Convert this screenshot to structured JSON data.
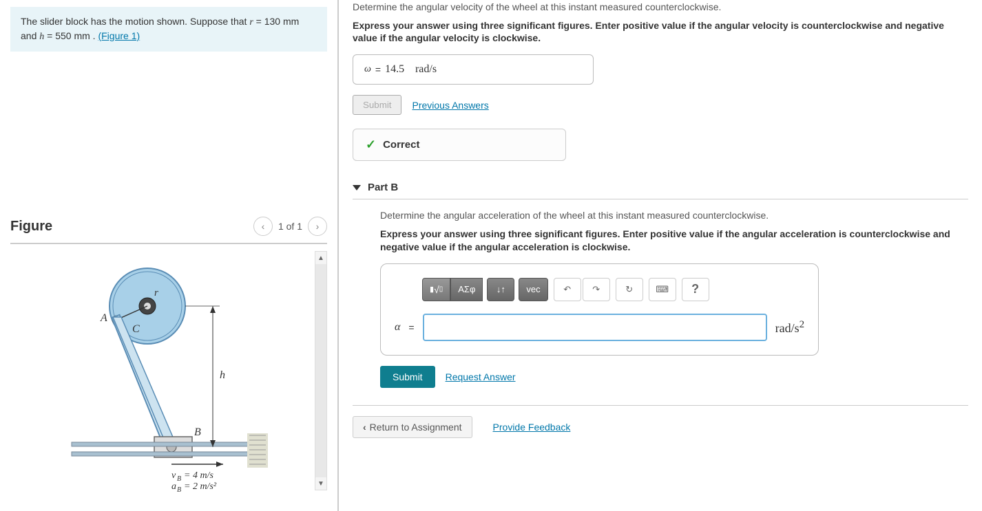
{
  "problem": {
    "text_prefix": "The slider block has the motion shown. Suppose that ",
    "r_var": "r",
    "r_val": " = 130  mm",
    "and_text": " and ",
    "h_var": "h",
    "h_val": " = 550  mm . ",
    "figure_link": "(Figure 1)"
  },
  "figure": {
    "title": "Figure",
    "counter": "1 of 1",
    "labels": {
      "A": "A",
      "B": "B",
      "C": "C",
      "r": "r",
      "h": "h"
    },
    "equations": {
      "vb": "v_B = 4 m/s",
      "ab": "a_B = 2 m/s²"
    }
  },
  "partA": {
    "question": "Determine the angular velocity of the wheel at this instant measured counterclockwise.",
    "instruction": "Express your answer using three significant figures. Enter positive value if the angular velocity is counterclockwise and negative value if the angular velocity is clockwise.",
    "var": "ω",
    "eq": " = ",
    "value": "14.5",
    "unit": "rad/s",
    "submit": "Submit",
    "prev_answers": "Previous Answers",
    "correct": "Correct"
  },
  "partB": {
    "header": "Part B",
    "question": "Determine the angular acceleration of the wheel at this instant measured counterclockwise.",
    "instruction": "Express your answer using three significant figures. Enter positive value if the angular acceleration is counterclockwise and negative value if the angular acceleration is clockwise.",
    "toolbar": {
      "templates": "▮√▯",
      "greek": "ΑΣφ",
      "arrows": "↓↑",
      "vec": "vec",
      "undo": "↶",
      "redo": "↷",
      "reset": "↻",
      "keyboard": "⌨",
      "help": "?"
    },
    "var": "α",
    "eq": " = ",
    "unit": "rad/s²",
    "submit": "Submit",
    "request_answer": "Request Answer"
  },
  "footer": {
    "return": "Return to Assignment",
    "feedback": "Provide Feedback"
  },
  "chart_data": {
    "type": "diagram",
    "description": "Mechanical linkage: wheel centered at top with radius r, connected via rod AC-CB to slider block B moving horizontally on a rail. Height h from wheel center to rail.",
    "parameters": {
      "r_mm": 130,
      "h_mm": 550,
      "v_B_mps": 4,
      "a_B_mps2": 2
    }
  }
}
